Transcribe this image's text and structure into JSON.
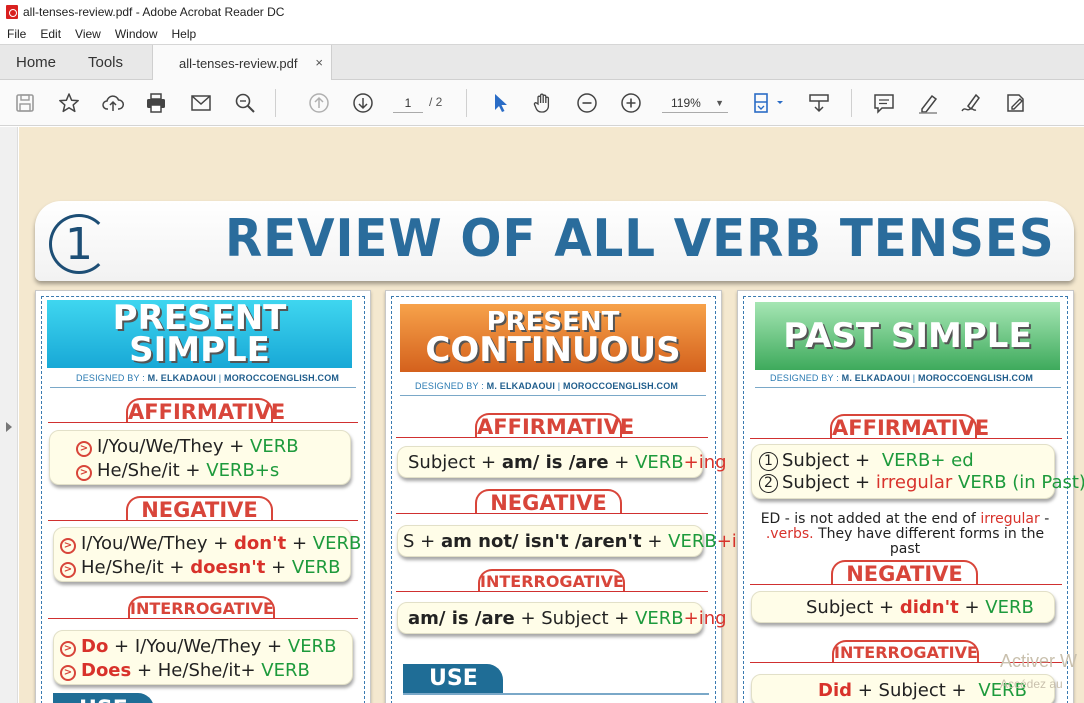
{
  "window": {
    "title": "all-tenses-review.pdf - Adobe Acrobat Reader DC"
  },
  "menu": [
    "File",
    "Edit",
    "View",
    "Window",
    "Help"
  ],
  "tabs": {
    "home": "Home",
    "tools": "Tools",
    "document": "all-tenses-review.pdf",
    "close": "×"
  },
  "toolbar": {
    "icons": [
      "save-icon",
      "bookmark-star-icon",
      "upload-cloud-icon",
      "print-icon",
      "email-icon",
      "search-zoom-icon",
      "page-up-icon",
      "page-down-icon",
      "select-cursor-icon",
      "hand-icon",
      "zoom-out-icon",
      "zoom-in-icon",
      "fit-page-icon",
      "scroll-mode-icon",
      "comment-icon",
      "highlight-icon",
      "sign-icon",
      "fill-sign-icon"
    ],
    "page_current": "1",
    "page_total": "/ 2",
    "zoom": "119%"
  },
  "document": {
    "banner": {
      "number": "1",
      "title": "REVIEW OF ALL VERB TENSES"
    },
    "credit": {
      "prefix": "DESIGNED BY :",
      "author": "M. ELKADAOUI",
      "sep": "|",
      "site": "MOROCCOENGLISH.COM"
    },
    "present_simple": {
      "title": "PRESENT SIMPLE",
      "affirmative": "AFFIRMATIVE",
      "aff_rows": [
        {
          "subject": "I/You/We/They +",
          "verb": "VERB"
        },
        {
          "subject": "He/She/it +",
          "verb": "VERB+s"
        }
      ],
      "negative": "NEGATIVE",
      "neg_rows": [
        {
          "subject": "I/You/We/They +",
          "aux": "don't",
          "plus": "+",
          "verb": "VERB"
        },
        {
          "subject": "He/She/it +",
          "aux": "doesn't",
          "plus": "+",
          "verb": "VERB"
        }
      ],
      "interrogative": "INTERROGATIVE",
      "int_rows": [
        {
          "aux": "Do",
          "rest": "+ I/You/We/They +",
          "verb": "VERB"
        },
        {
          "aux": "Does",
          "rest": "+ He/She/it+",
          "verb": "VERB"
        }
      ],
      "use": "USE"
    },
    "present_continuous": {
      "title_line1": "PRESENT",
      "title_line2": "CONTINUOUS",
      "affirmative": "AFFIRMATIVE",
      "aff": {
        "subject": "Subject +",
        "aux": "am/ is /are",
        "plus": "+",
        "verb": "VERB",
        "suffix": "+ing"
      },
      "negative": "NEGATIVE",
      "neg": {
        "subject": "S +",
        "aux": "am not/ isn't /aren't",
        "plus": "+",
        "verb": "VERB",
        "suffix": "+ing"
      },
      "interrogative": "INTERROGATIVE",
      "int": {
        "aux": "am/ is /are",
        "rest": "+ Subject +",
        "verb": "VERB",
        "suffix": "+ing"
      },
      "use": "USE"
    },
    "past_simple": {
      "title": "PAST SIMPLE",
      "affirmative": "AFFIRMATIVE",
      "aff_rows": [
        {
          "n": "1",
          "subject": "Subject +",
          "verb": "VERB+ ed",
          "extra": ""
        },
        {
          "n": "2",
          "subject": "Subject +",
          "irregular": "irregular",
          "verb": "VERB (in Past)"
        }
      ],
      "note_a": "ED - is not added at the end of",
      "note_irr": "irregular",
      "note_b": "-",
      "note_c": ".verbs.",
      "note_d": "They have different forms in the past",
      "negative": "NEGATIVE",
      "neg": {
        "subject": "Subject +",
        "aux": "didn't",
        "plus": "+",
        "verb": "VERB"
      },
      "interrogative": "INTERROGATIVE",
      "int": {
        "aux": "Did",
        "rest": "+ Subject +",
        "verb": "VERB"
      }
    },
    "watermark": {
      "line1": "Activer W",
      "line2": "Accédez au"
    }
  }
}
